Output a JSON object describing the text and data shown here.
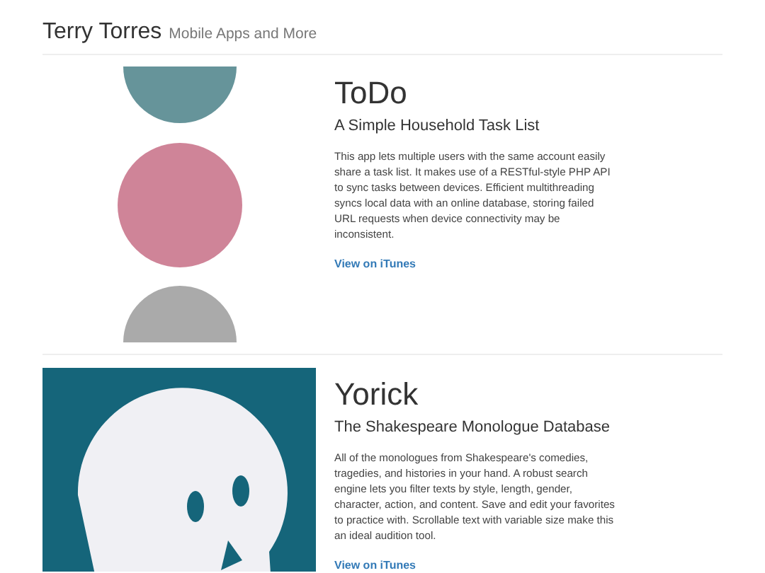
{
  "header": {
    "name": "Terry Torres",
    "tagline": "Mobile Apps and More"
  },
  "apps": [
    {
      "kind": "dots",
      "title": "ToDo",
      "subtitle": "A Simple Household Task List",
      "description": "This app lets multiple users with the same account easily share a task list. It makes use of a RESTful-style PHP API to sync tasks between devices. Efficient multithreading syncs local data with an online database, storing failed URL requests when device connectivity may be inconsistent.",
      "link": "View on iTunes"
    },
    {
      "kind": "skull",
      "title": "Yorick",
      "subtitle": "The Shakespeare Monologue Database",
      "description": "All of the monologues from Shakespeare's comedies, tragedies, and histories in your hand. A robust search engine lets you filter texts by style, length, gender, character, action, and content. Save and edit your favorites to practice with. Scrollable text with variable size make this an ideal audition tool.",
      "link": "View on iTunes"
    }
  ]
}
